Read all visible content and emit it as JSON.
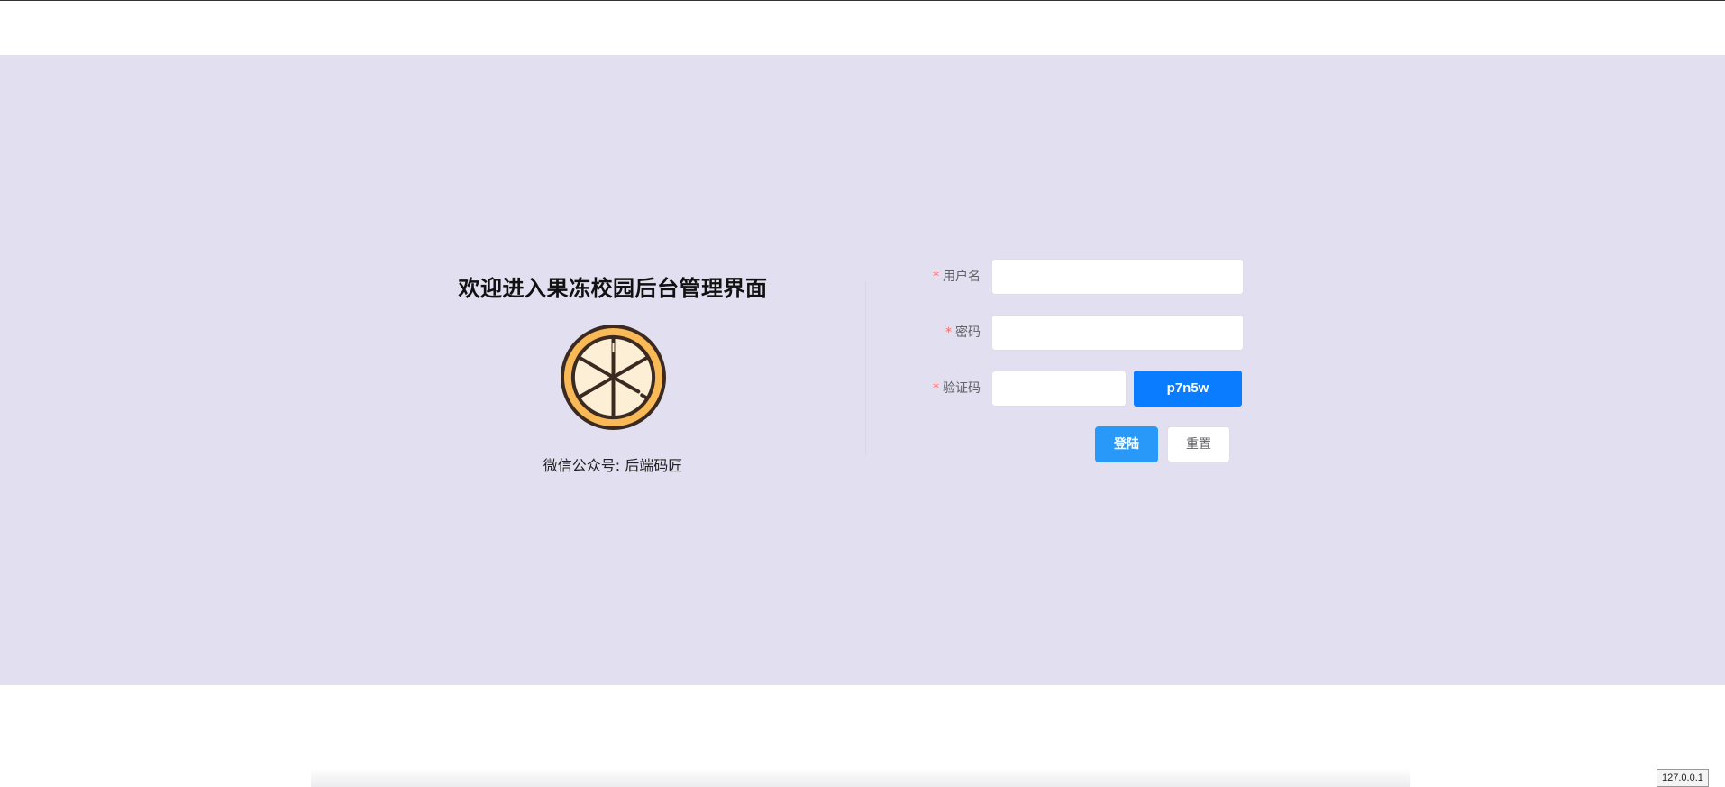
{
  "login": {
    "welcome_title": "欢迎进入果冻校园后台管理界面",
    "wechat_text": "微信公众号: 后端码匠",
    "username_label": "用户名",
    "password_label": "密码",
    "captcha_label": "验证码",
    "required_mark": "*",
    "username_value": "",
    "password_value": "",
    "captcha_value": "",
    "captcha_code": "p7n5w",
    "login_button": "登陆",
    "reset_button": "重置"
  },
  "status": {
    "host": "127.0.0.1"
  },
  "colors": {
    "band_background": "#e1dff0",
    "primary": "#2999f9",
    "captcha_bg": "#0a7cff",
    "logo_rim": "#f9b957",
    "logo_inner": "#fdefd6",
    "logo_stroke": "#3b2a22"
  },
  "icons": {
    "logo": "orange-slice-icon"
  }
}
